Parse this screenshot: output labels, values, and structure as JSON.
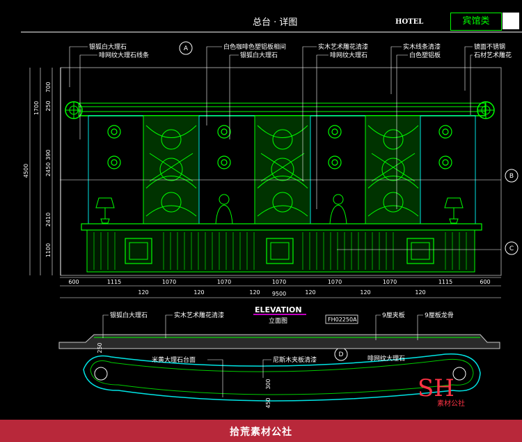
{
  "header": {
    "title": "总台 · 详图",
    "hotel_label": "HOTEL",
    "category": "宾馆类"
  },
  "section_markers": [
    "A",
    "B",
    "C",
    "D"
  ],
  "callouts_top": [
    "银狐白大理石",
    "啡网纹大理石线条",
    "白色咖啡色塑铝板相间",
    "银狐白大理石",
    "实木艺术雕花清漆",
    "啡网纹大理石",
    "实木线条清漆",
    "白色塑铝板",
    "镜面不锈钢",
    "石材艺术雕花"
  ],
  "left_dims": [
    "700",
    "250",
    "1700",
    "390",
    "2450",
    "4500",
    "2410",
    "1100"
  ],
  "bottom_dims_row1": [
    "600",
    "1115",
    "1070",
    "1070",
    "1070",
    "1070",
    "1070",
    "1115",
    "600"
  ],
  "bottom_dims_row2": [
    "120",
    "120",
    "120",
    "120",
    "120",
    "120"
  ],
  "total_width": "9500",
  "elevation": {
    "title": "ELEVATION",
    "subtitle": "立面图",
    "code": "FH02250A"
  },
  "plan_callouts": [
    "银狐白大理石",
    "实木艺术雕花清漆",
    "9厘夹板",
    "9厘板龙骨",
    "米黄大理石台面",
    "尼斯木夹板清漆",
    "啡网纹大理石"
  ],
  "plan_dims": [
    "250",
    "300",
    "450"
  ],
  "watermark": {
    "logo": "SH",
    "text": "素材公社"
  },
  "footer": {
    "text": "拾荒素材公社"
  }
}
